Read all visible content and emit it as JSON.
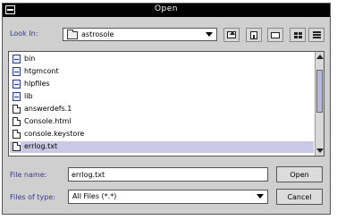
{
  "window": {
    "title": "Open"
  },
  "look_in": {
    "label": "Look In:",
    "value": "astrosole",
    "icon": "folder-icon"
  },
  "toolbar": {
    "buttons": [
      {
        "name": "up-one-level-button",
        "icon": "up-folder-icon"
      },
      {
        "name": "home-button",
        "icon": "home-icon"
      },
      {
        "name": "new-folder-button",
        "icon": "new-folder-icon"
      },
      {
        "name": "list-view-button",
        "icon": "list-view-icon"
      },
      {
        "name": "details-view-button",
        "icon": "details-view-icon"
      }
    ]
  },
  "file_list": {
    "items": [
      {
        "name": "bin",
        "type": "folder"
      },
      {
        "name": "htgmcont",
        "type": "folder"
      },
      {
        "name": "hlpfiles",
        "type": "folder"
      },
      {
        "name": "lib",
        "type": "folder"
      },
      {
        "name": "answerdefs.1",
        "type": "file"
      },
      {
        "name": "Console.html",
        "type": "file"
      },
      {
        "name": "console.keystore",
        "type": "file"
      },
      {
        "name": "errlog.txt",
        "type": "file",
        "selected": true
      }
    ]
  },
  "file_name": {
    "label": "File name:",
    "value": "errlog.txt"
  },
  "files_of_type": {
    "label": "Files of type:",
    "value": "All Files (*.*)"
  },
  "buttons": {
    "open": "Open",
    "cancel": "Cancel"
  },
  "colors": {
    "selection": "#c9c9e6",
    "label": "#3a3a8a",
    "titlebar": "#000000"
  }
}
